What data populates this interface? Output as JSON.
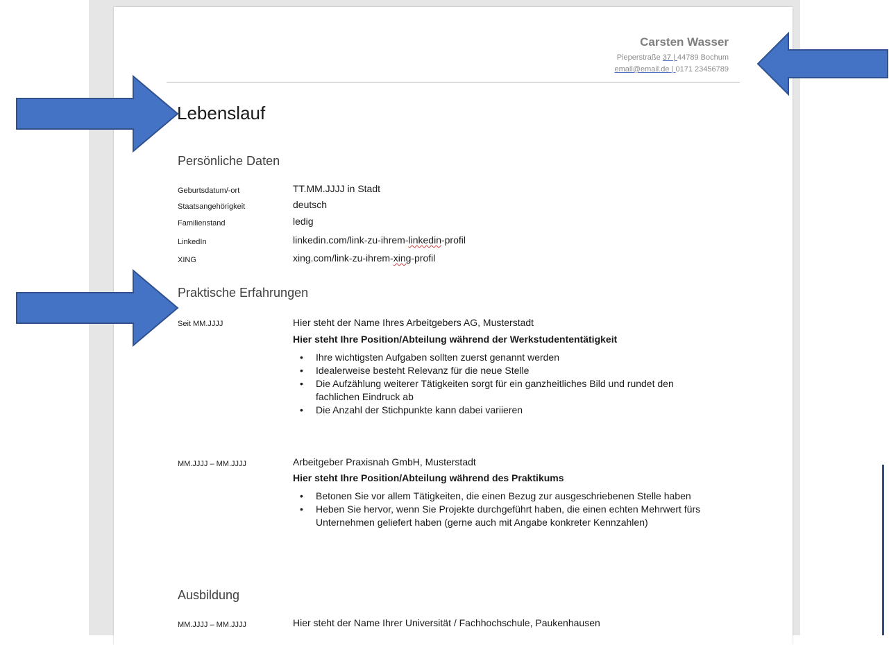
{
  "header": {
    "name": "Carsten Wasser",
    "street_prefix": "Pieperstraße ",
    "street_number": "37",
    "sep": "|",
    "city": "44789 Bochum",
    "email": "email@email.de",
    "phone": "0171 23456789"
  },
  "title": "Lebenslauf",
  "personal": {
    "heading": "Persönliche Daten",
    "rows": [
      {
        "label": "Geburtsdatum/-ort",
        "value": "TT.MM.JJJJ in Stadt"
      },
      {
        "label": "Staatsangehörigkeit",
        "value": "deutsch"
      },
      {
        "label": "Familienstand",
        "value": "ledig"
      },
      {
        "label": "LinkedIn",
        "value_pre": "linkedin.com/link-zu-ihrem-",
        "value_spell": "linkedin",
        "value_post": "-profil"
      },
      {
        "label": "XING",
        "value_pre": "xing.com/link-zu-ihrem-",
        "value_spell": "xing",
        "value_post": "-profil"
      }
    ]
  },
  "experience": {
    "heading": "Praktische Erfahrungen",
    "entries": [
      {
        "date": "Seit MM.JJJJ",
        "employer": "Hier steht der Name Ihres Arbeitgebers AG, Musterstadt",
        "position": "Hier steht Ihre Position/Abteilung während der Werkstudententätigkeit",
        "bullets": [
          "Ihre wichtigsten Aufgaben sollten zuerst genannt werden",
          "Idealerweise besteht Relevanz für die neue Stelle",
          "Die Aufzählung weiterer Tätigkeiten sorgt für ein ganzheitliches Bild und rundet den fachlichen Eindruck ab",
          "Die Anzahl der Stichpunkte kann dabei variieren"
        ]
      },
      {
        "date": "MM.JJJJ – MM.JJJJ",
        "employer": "Arbeitgeber Praxisnah GmbH, Musterstadt",
        "position": "Hier steht Ihre Position/Abteilung während des Praktikums",
        "bullets": [
          "Betonen Sie vor allem Tätigkeiten, die einen Bezug zur ausgeschriebenen Stelle haben",
          "Heben Sie hervor, wenn Sie Projekte durchgeführt haben, die einen echten Mehrwert fürs Unternehmen geliefert haben (gerne auch mit Angabe konkreter Kennzahlen)"
        ]
      }
    ]
  },
  "education": {
    "heading": "Ausbildung",
    "entries": [
      {
        "date": "MM.JJJJ – MM.JJJJ",
        "institution": "Hier steht der Name Ihrer Universität / Fachhochschule, Paukenhausen"
      }
    ]
  },
  "colors": {
    "arrow": "#4472c4",
    "arrow_border": "#2f528f",
    "spellcheck": "#d23a3a"
  }
}
